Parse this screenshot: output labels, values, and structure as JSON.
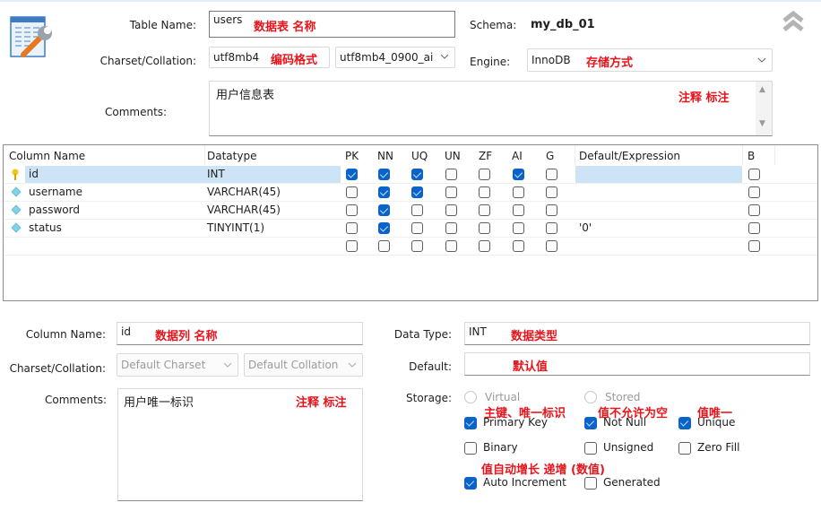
{
  "header": {
    "table_name_label": "Table Name:",
    "table_name_value": "users",
    "table_name_annotation": "数据表 名称",
    "schema_label": "Schema:",
    "schema_value": "my_db_01",
    "charset_label": "Charset/Collation:",
    "charset_value": "utf8mb4",
    "charset_annotation": "编码格式",
    "collation_value": "utf8mb4_0900_ai",
    "engine_label": "Engine:",
    "engine_value": "InnoDB",
    "engine_annotation": "存储方式",
    "comments_label": "Comments:",
    "comments_value": "用户信息表",
    "comments_annotation": "注释 标注",
    "collapse_icon": "double-chevron-up-icon"
  },
  "grid": {
    "columns": [
      "Column Name",
      "Datatype",
      "PK",
      "NN",
      "UQ",
      "UN",
      "ZF",
      "AI",
      "G",
      "Default/Expression",
      "B"
    ],
    "rows": [
      {
        "icon": "primary-key-icon",
        "name": "id",
        "datatype": "INT",
        "pk": true,
        "nn": true,
        "uq": true,
        "un": false,
        "zf": false,
        "ai": true,
        "g": false,
        "default": "",
        "b": false,
        "selected": true
      },
      {
        "icon": "column-diamond-icon",
        "name": "username",
        "datatype": "VARCHAR(45)",
        "pk": false,
        "nn": true,
        "uq": true,
        "un": false,
        "zf": false,
        "ai": false,
        "g": false,
        "default": "",
        "b": false,
        "selected": false
      },
      {
        "icon": "column-diamond-icon",
        "name": "password",
        "datatype": "VARCHAR(45)",
        "pk": false,
        "nn": true,
        "uq": false,
        "un": false,
        "zf": false,
        "ai": false,
        "g": false,
        "default": "",
        "b": false,
        "selected": false
      },
      {
        "icon": "column-diamond-icon",
        "name": "status",
        "datatype": "TINYINT(1)",
        "pk": false,
        "nn": true,
        "uq": false,
        "un": false,
        "zf": false,
        "ai": false,
        "g": false,
        "default": "'0'",
        "b": false,
        "selected": false
      },
      {
        "icon": "",
        "name": "",
        "datatype": "",
        "pk": false,
        "nn": false,
        "uq": false,
        "un": false,
        "zf": false,
        "ai": false,
        "g": false,
        "default": "",
        "b": false,
        "selected": false
      }
    ]
  },
  "detail": {
    "column_name_label": "Column Name:",
    "column_name_value": "id",
    "column_name_annotation": "数据列 名称",
    "charset_label": "Charset/Collation:",
    "charset_value": "Default Charset",
    "collation_value": "Default Collation",
    "comments_label": "Comments:",
    "comments_value": "用户唯一标识",
    "comments_annotation": "注释 标注",
    "data_type_label": "Data Type:",
    "data_type_value": "INT",
    "data_type_annotation": "数据类型",
    "default_label": "Default:",
    "default_value": "",
    "default_annotation": "默认值",
    "storage_label": "Storage:",
    "storage_options": [
      "Virtual",
      "Stored"
    ],
    "flags": {
      "primary_key": {
        "label": "Primary Key",
        "checked": true,
        "annotation": "主键、唯一标识"
      },
      "not_null": {
        "label": "Not Null",
        "checked": true,
        "annotation": "值不允许为空"
      },
      "unique": {
        "label": "Unique",
        "checked": true,
        "annotation": "值唯一"
      },
      "binary": {
        "label": "Binary",
        "checked": false
      },
      "unsigned": {
        "label": "Unsigned",
        "checked": false
      },
      "zero_fill": {
        "label": "Zero Fill",
        "checked": false
      },
      "auto_increment": {
        "label": "Auto Increment",
        "checked": true,
        "annotation": "值自动增长 递增 (数值)"
      },
      "generated": {
        "label": "Generated",
        "checked": false
      }
    }
  },
  "colors": {
    "annotation": "#e8141b",
    "checkbox_checked": "#0a63c9",
    "selection": "#cde4f7"
  }
}
